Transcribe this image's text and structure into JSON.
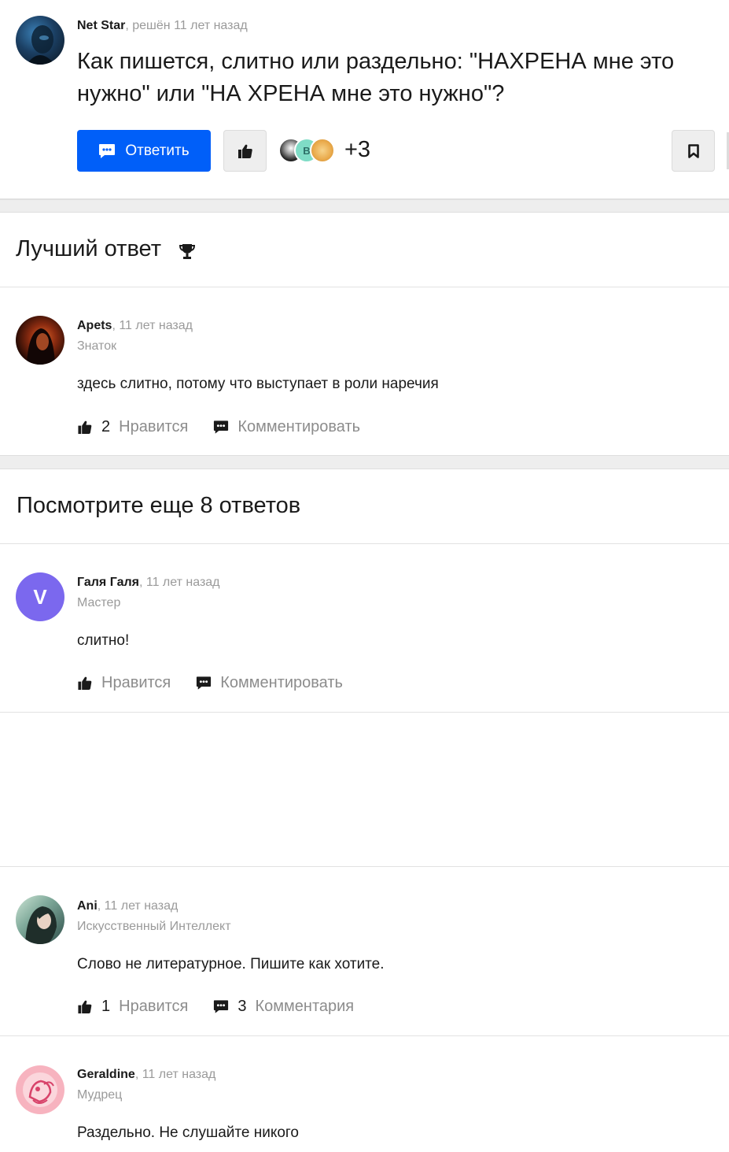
{
  "question": {
    "author": "Net Star",
    "meta": ", решён 11 лет назад",
    "title": "Как пишется, слитно или раздельно: \"НАХРЕНА мне это нужно\" или \"НА ХРЕНА мне это нужно\"?",
    "answer_button": "Ответить",
    "likers": [
      {
        "initial": ""
      },
      {
        "initial": "В"
      },
      {
        "initial": ""
      }
    ],
    "likers_extra": "+3"
  },
  "best_section": {
    "title": "Лучший ответ"
  },
  "more_section": {
    "title": "Посмотрите еще 8 ответов"
  },
  "answers": [
    {
      "author": "Apets",
      "time": ", 11 лет назад",
      "rank": "Знаток",
      "text": "здесь слитно, потому что выступает в роли наречия",
      "likes": "2",
      "like_label": "Нравится",
      "comments": "",
      "comment_label": "Комментировать"
    },
    {
      "author": "Галя Галя",
      "time": ", 11 лет назад",
      "rank": "Мастер",
      "avatar_letter": "V",
      "text": "слитно!",
      "likes": "",
      "like_label": "Нравится",
      "comments": "",
      "comment_label": "Комментировать"
    },
    {
      "author": "Ani",
      "time": ", 11 лет назад",
      "rank": "Искусственный Интеллект",
      "text": "Слово не литературное. Пишите как хотите.",
      "likes": "1",
      "like_label": "Нравится",
      "comments": "3",
      "comment_label": "Комментария"
    },
    {
      "author": "Geraldine",
      "time": ", 11 лет назад",
      "rank": "Мудрец",
      "text": "Раздельно. Не слушайте никого"
    }
  ],
  "colors": {
    "accent": "#005ff9",
    "muted": "#9a9a9a",
    "divider": "#eeeeee",
    "violet_avatar": "#7b68ee"
  }
}
